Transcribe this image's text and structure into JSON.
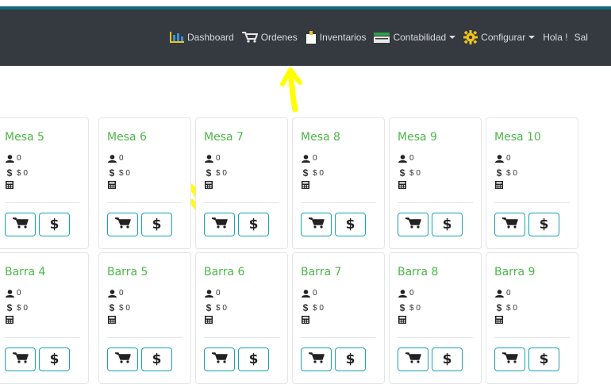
{
  "navbar": {
    "items": [
      {
        "label": "Dashboard",
        "icon": "chart-bar-icon"
      },
      {
        "label": "Ordenes",
        "icon": "cart-icon"
      },
      {
        "label": "Inventarios",
        "icon": "dolly-icon"
      },
      {
        "label": "Contabilidad",
        "icon": "cash-register-icon",
        "dropdown": true
      },
      {
        "label": "Configurar",
        "icon": "cog-icon",
        "dropdown": true
      }
    ],
    "greeting": "Hola !",
    "logout": "Sal"
  },
  "colors": {
    "navbar_bg": "#343a40",
    "title_green": "#4cb748",
    "button_border": "#17a2b8",
    "highlight_yellow": "#ffff00"
  },
  "cards": [
    {
      "title": "Mesa 5",
      "guests": "0",
      "amount": "$ 0"
    },
    {
      "title": "Mesa 6",
      "guests": "0",
      "amount": "$ 0"
    },
    {
      "title": "Mesa 7",
      "guests": "0",
      "amount": "$ 0"
    },
    {
      "title": "Mesa 8",
      "guests": "0",
      "amount": "$ 0"
    },
    {
      "title": "Mesa 9",
      "guests": "0",
      "amount": "$ 0"
    },
    {
      "title": "Mesa 10",
      "guests": "0",
      "amount": "$ 0"
    },
    {
      "title": "Barra 4",
      "guests": "0",
      "amount": "$ 0"
    },
    {
      "title": "Barra 5",
      "guests": "0",
      "amount": "$ 0"
    },
    {
      "title": "Barra 6",
      "guests": "0",
      "amount": "$ 0"
    },
    {
      "title": "Barra 7",
      "guests": "0",
      "amount": "$ 0"
    },
    {
      "title": "Barra 8",
      "guests": "0",
      "amount": "$ 0"
    },
    {
      "title": "Barra 9",
      "guests": "0",
      "amount": "$ 0"
    }
  ],
  "card_button_symbol": "$"
}
